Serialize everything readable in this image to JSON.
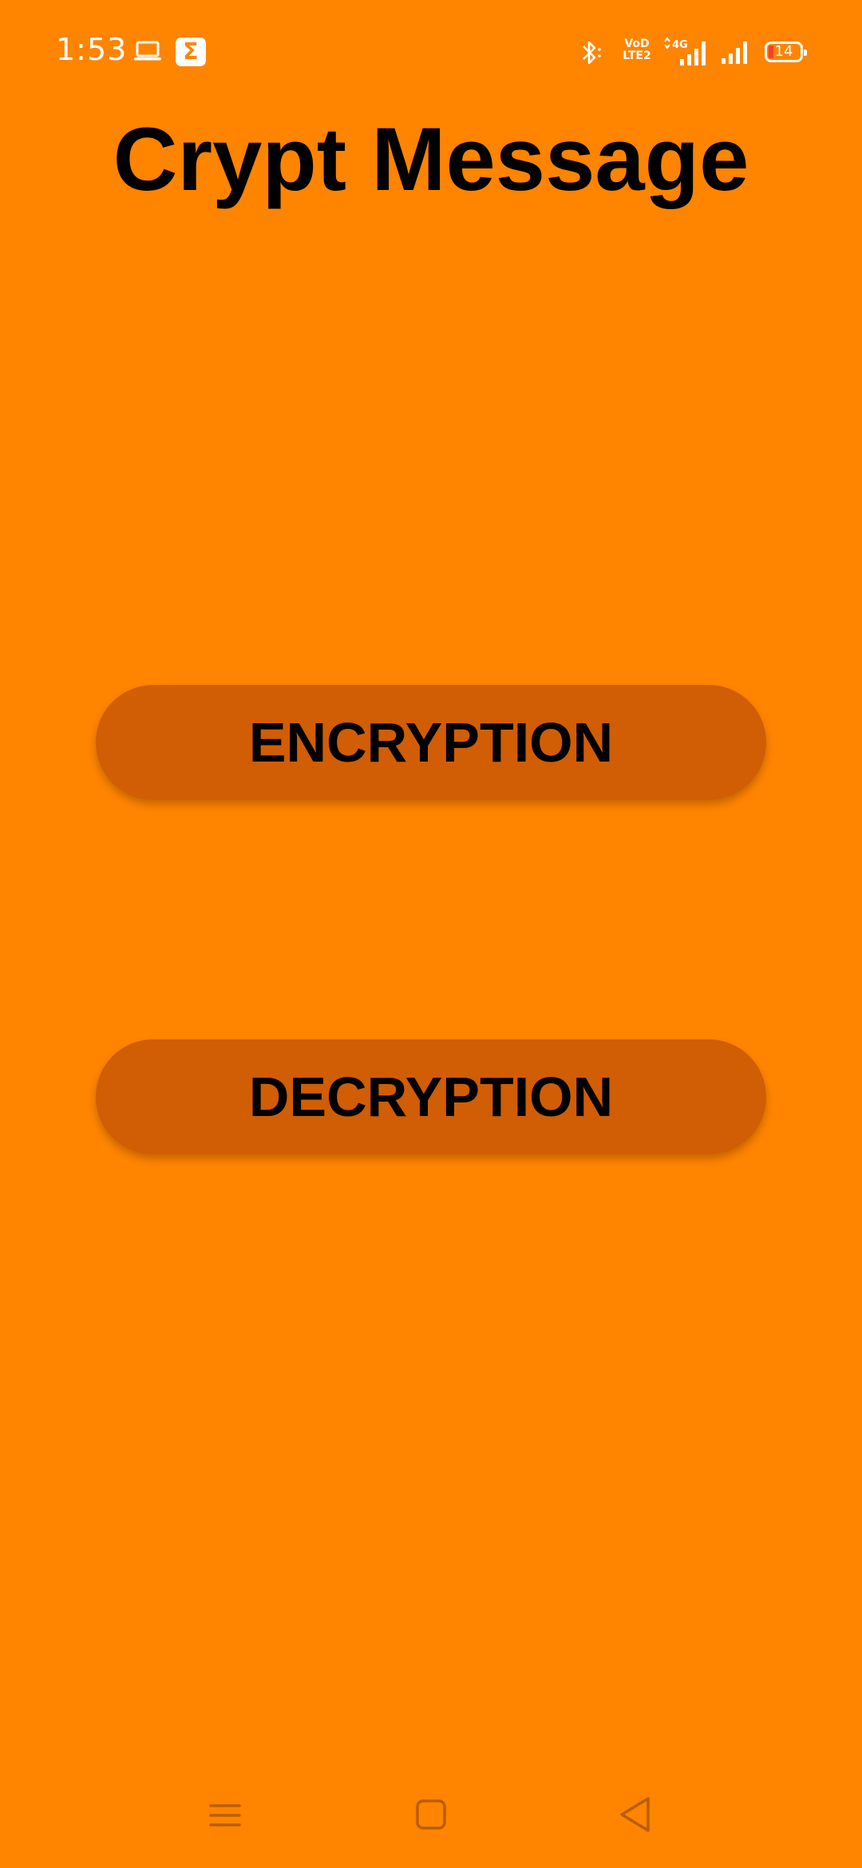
{
  "status_bar": {
    "time": "1:53",
    "icons": [
      "laptop-icon",
      "sigma-app-icon",
      "bluetooth-icon",
      "volte-icon",
      "signal-4g-icon",
      "signal-icon",
      "battery-icon"
    ],
    "volte_text_top": "VoD",
    "volte_text_bottom": "LTE2",
    "network_label": "4G",
    "battery_level": "14"
  },
  "app": {
    "title": "Crypt Message"
  },
  "buttons": {
    "encryption": "ENCRYPTION",
    "decryption": "DECRYPTION"
  },
  "nav_bar": {
    "icons": [
      "menu-icon",
      "home-icon",
      "back-icon"
    ]
  },
  "colors": {
    "background": "#FF8400",
    "button": "#D15D04",
    "text": "#000000"
  }
}
